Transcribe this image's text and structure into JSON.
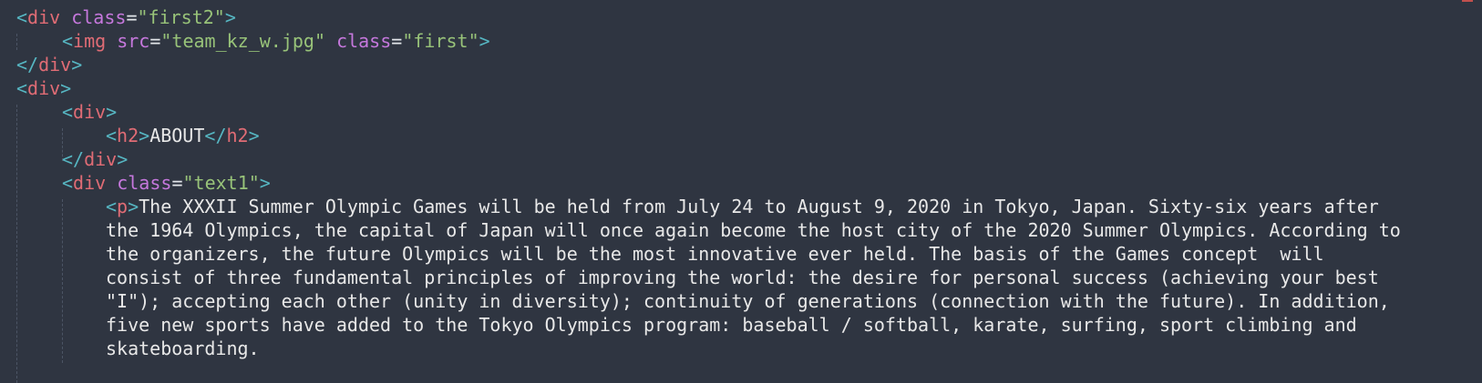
{
  "code": {
    "l1": {
      "tag": "div",
      "attr": "class",
      "value": "\"first2\""
    },
    "l2": {
      "tag": "img",
      "attr1": "src",
      "value1": "\"team_kz_w.jpg\"",
      "attr2": "class",
      "value2": "\"first\""
    },
    "l3": {
      "tag": "div"
    },
    "l4": {
      "tag": "div"
    },
    "l5": {
      "tag": "div"
    },
    "l6": {
      "tag": "h2",
      "text": "ABOUT"
    },
    "l7": {
      "tag": "div"
    },
    "l8": {
      "tag": "div",
      "attr": "class",
      "value": "\"text1\""
    },
    "l9": {
      "tag": "p",
      "text": "The XXXII Summer Olympic Games will be held from July 24 to August 9, 2020 in Tokyo, Japan. Sixty-six years after"
    },
    "l10": "the 1964 Olympics, the capital of Japan will once again become the host city of the 2020 Summer Olympics. According to",
    "l11": "the organizers, the future Olympics will be the most innovative ever held. The basis of the Games concept  will",
    "l12": "consist of three fundamental principles of improving the world: the desire for personal success (achieving your best",
    "l13": "\"I\"); accepting each other (unity in diversity); continuity of generations (connection with the future). In addition,",
    "l14": "five new sports have added to the Tokyo Olympics program: baseball / softball, karate, surfing, sport climbing and",
    "l15": "skateboarding."
  },
  "syntax": {
    "tag": "<",
    "close_tag": "</",
    "end": ">",
    "eq": "="
  }
}
